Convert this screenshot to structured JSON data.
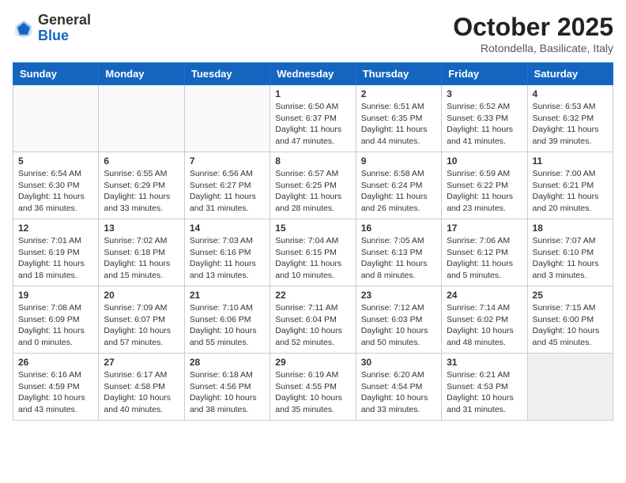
{
  "header": {
    "logo_line1": "General",
    "logo_line2": "Blue",
    "month": "October 2025",
    "location": "Rotondella, Basilicate, Italy"
  },
  "days_of_week": [
    "Sunday",
    "Monday",
    "Tuesday",
    "Wednesday",
    "Thursday",
    "Friday",
    "Saturday"
  ],
  "weeks": [
    [
      {
        "day": "",
        "info": ""
      },
      {
        "day": "",
        "info": ""
      },
      {
        "day": "",
        "info": ""
      },
      {
        "day": "1",
        "info": "Sunrise: 6:50 AM\nSunset: 6:37 PM\nDaylight: 11 hours\nand 47 minutes."
      },
      {
        "day": "2",
        "info": "Sunrise: 6:51 AM\nSunset: 6:35 PM\nDaylight: 11 hours\nand 44 minutes."
      },
      {
        "day": "3",
        "info": "Sunrise: 6:52 AM\nSunset: 6:33 PM\nDaylight: 11 hours\nand 41 minutes."
      },
      {
        "day": "4",
        "info": "Sunrise: 6:53 AM\nSunset: 6:32 PM\nDaylight: 11 hours\nand 39 minutes."
      }
    ],
    [
      {
        "day": "5",
        "info": "Sunrise: 6:54 AM\nSunset: 6:30 PM\nDaylight: 11 hours\nand 36 minutes."
      },
      {
        "day": "6",
        "info": "Sunrise: 6:55 AM\nSunset: 6:29 PM\nDaylight: 11 hours\nand 33 minutes."
      },
      {
        "day": "7",
        "info": "Sunrise: 6:56 AM\nSunset: 6:27 PM\nDaylight: 11 hours\nand 31 minutes."
      },
      {
        "day": "8",
        "info": "Sunrise: 6:57 AM\nSunset: 6:25 PM\nDaylight: 11 hours\nand 28 minutes."
      },
      {
        "day": "9",
        "info": "Sunrise: 6:58 AM\nSunset: 6:24 PM\nDaylight: 11 hours\nand 26 minutes."
      },
      {
        "day": "10",
        "info": "Sunrise: 6:59 AM\nSunset: 6:22 PM\nDaylight: 11 hours\nand 23 minutes."
      },
      {
        "day": "11",
        "info": "Sunrise: 7:00 AM\nSunset: 6:21 PM\nDaylight: 11 hours\nand 20 minutes."
      }
    ],
    [
      {
        "day": "12",
        "info": "Sunrise: 7:01 AM\nSunset: 6:19 PM\nDaylight: 11 hours\nand 18 minutes."
      },
      {
        "day": "13",
        "info": "Sunrise: 7:02 AM\nSunset: 6:18 PM\nDaylight: 11 hours\nand 15 minutes."
      },
      {
        "day": "14",
        "info": "Sunrise: 7:03 AM\nSunset: 6:16 PM\nDaylight: 11 hours\nand 13 minutes."
      },
      {
        "day": "15",
        "info": "Sunrise: 7:04 AM\nSunset: 6:15 PM\nDaylight: 11 hours\nand 10 minutes."
      },
      {
        "day": "16",
        "info": "Sunrise: 7:05 AM\nSunset: 6:13 PM\nDaylight: 11 hours\nand 8 minutes."
      },
      {
        "day": "17",
        "info": "Sunrise: 7:06 AM\nSunset: 6:12 PM\nDaylight: 11 hours\nand 5 minutes."
      },
      {
        "day": "18",
        "info": "Sunrise: 7:07 AM\nSunset: 6:10 PM\nDaylight: 11 hours\nand 3 minutes."
      }
    ],
    [
      {
        "day": "19",
        "info": "Sunrise: 7:08 AM\nSunset: 6:09 PM\nDaylight: 11 hours\nand 0 minutes."
      },
      {
        "day": "20",
        "info": "Sunrise: 7:09 AM\nSunset: 6:07 PM\nDaylight: 10 hours\nand 57 minutes."
      },
      {
        "day": "21",
        "info": "Sunrise: 7:10 AM\nSunset: 6:06 PM\nDaylight: 10 hours\nand 55 minutes."
      },
      {
        "day": "22",
        "info": "Sunrise: 7:11 AM\nSunset: 6:04 PM\nDaylight: 10 hours\nand 52 minutes."
      },
      {
        "day": "23",
        "info": "Sunrise: 7:12 AM\nSunset: 6:03 PM\nDaylight: 10 hours\nand 50 minutes."
      },
      {
        "day": "24",
        "info": "Sunrise: 7:14 AM\nSunset: 6:02 PM\nDaylight: 10 hours\nand 48 minutes."
      },
      {
        "day": "25",
        "info": "Sunrise: 7:15 AM\nSunset: 6:00 PM\nDaylight: 10 hours\nand 45 minutes."
      }
    ],
    [
      {
        "day": "26",
        "info": "Sunrise: 6:16 AM\nSunset: 4:59 PM\nDaylight: 10 hours\nand 43 minutes."
      },
      {
        "day": "27",
        "info": "Sunrise: 6:17 AM\nSunset: 4:58 PM\nDaylight: 10 hours\nand 40 minutes."
      },
      {
        "day": "28",
        "info": "Sunrise: 6:18 AM\nSunset: 4:56 PM\nDaylight: 10 hours\nand 38 minutes."
      },
      {
        "day": "29",
        "info": "Sunrise: 6:19 AM\nSunset: 4:55 PM\nDaylight: 10 hours\nand 35 minutes."
      },
      {
        "day": "30",
        "info": "Sunrise: 6:20 AM\nSunset: 4:54 PM\nDaylight: 10 hours\nand 33 minutes."
      },
      {
        "day": "31",
        "info": "Sunrise: 6:21 AM\nSunset: 4:53 PM\nDaylight: 10 hours\nand 31 minutes."
      },
      {
        "day": "",
        "info": ""
      }
    ]
  ]
}
